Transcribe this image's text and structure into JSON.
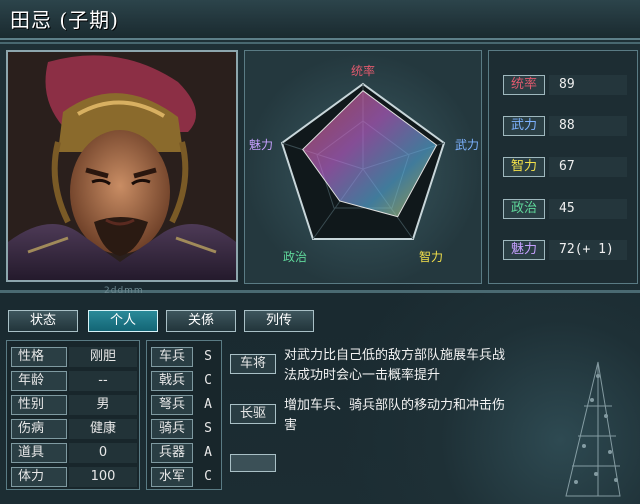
{
  "header": {
    "title": "田忌 (子期)"
  },
  "radar": {
    "labels": {
      "tong": "统率",
      "wu": "武力",
      "zhi": "智力",
      "zheng": "政治",
      "mei": "魅力"
    }
  },
  "stats": [
    {
      "label": "统率",
      "value": "89",
      "color": "#e05a6e"
    },
    {
      "label": "武力",
      "value": "88",
      "color": "#7db2ff"
    },
    {
      "label": "智力",
      "value": "67",
      "color": "#f2e04a"
    },
    {
      "label": "政治",
      "value": "45",
      "color": "#5fd79a"
    },
    {
      "label": "魅力",
      "value": "72(+ 1)",
      "color": "#c6a0ff"
    }
  ],
  "watermark": "2ddmm",
  "tabs": [
    {
      "label": "状态",
      "active": false
    },
    {
      "label": "个人",
      "active": true
    },
    {
      "label": "关係",
      "active": false
    },
    {
      "label": "列传",
      "active": false
    }
  ],
  "info": [
    {
      "label": "性格",
      "value": "刚胆"
    },
    {
      "label": "年龄",
      "value": "--"
    },
    {
      "label": "性别",
      "value": "男"
    },
    {
      "label": "伤病",
      "value": "健康"
    },
    {
      "label": "道具",
      "value": "0"
    },
    {
      "label": "体力",
      "value": "100"
    }
  ],
  "troops": [
    {
      "label": "车兵",
      "grade": "S"
    },
    {
      "label": "戟兵",
      "grade": "C"
    },
    {
      "label": "弩兵",
      "grade": "A"
    },
    {
      "label": "骑兵",
      "grade": "S"
    },
    {
      "label": "兵器",
      "grade": "A"
    },
    {
      "label": "水军",
      "grade": "C"
    }
  ],
  "skills": [
    {
      "name": "车将",
      "desc_line1": "对武力比自己低的敌方部队施展车兵战",
      "desc_line2": "法成功时会心一击概率提升"
    },
    {
      "name": "长驱",
      "desc_line1": "增加车兵、骑兵部队的移动力和冲击伤",
      "desc_line2": "害"
    }
  ]
}
